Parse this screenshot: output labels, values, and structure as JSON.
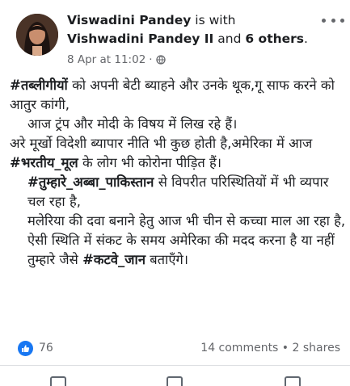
{
  "post": {
    "author": "Viswadini Pandey",
    "with_text": "is with",
    "tagged_name": "Vishwadini Pandey II",
    "and_text": "and",
    "others": "6 others",
    "period": ".",
    "timestamp": "8 Apr at 11:02",
    "separator": "·",
    "privacy_icon": "globe-icon",
    "more_icon": "more-options-icon"
  },
  "body": {
    "p1_tag": "#तब्लीगीयों",
    "p1_rest": " को अपनी बेटी ब्याहने और उनके थूक,गू साफ करने को आतुर कांगी,",
    "p2": "आज ट्रंप और मोदी के विषय में लिख रहे हैं।",
    "p3": "अरे मूर्खो विदेशी ब्यापार नीति भी कुछ होती है,अमेरिका में आज ",
    "p3_tag": "#भरतीय_मूल",
    "p3_rest": " के लोग भी कोरोना पीड़ित हैं।",
    "p4_tag": "#तुम्हारे_अब्बा_पाकिस्तान",
    "p4_rest": " से विपरीत परिस्थितियों में भी व्यपार चल रहा है,",
    "p5": "मलेरिया की दवा बनाने हेतु आज भी चीन से कच्चा माल आ रहा है, ऐसी स्थिति में संकट के समय अमेरिका की मदद करना है या नहीं तुम्हारे जैसे ",
    "p5_tag": "#कटवे_जान",
    "p5_rest": " बताएँगे।"
  },
  "footer": {
    "likes": "76",
    "comments": "14 comments",
    "dot": " • ",
    "shares": "2 shares",
    "accent": "#1877f2"
  }
}
